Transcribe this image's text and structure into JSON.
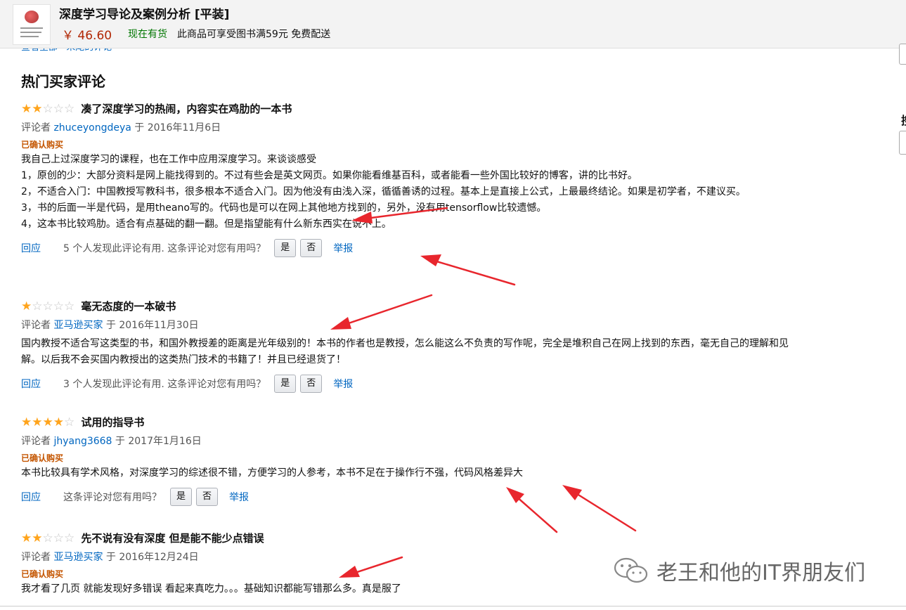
{
  "header": {
    "product_title": "深度学习导论及案例分析 [平装]",
    "price": "￥ 46.60",
    "stock": "现在有货",
    "promo": "此商品可享受图书满59元 免费配送",
    "cut_link": "查看全部 · 末尾的评论"
  },
  "section_title": "热门买家评论",
  "reviews": [
    {
      "rating": 2,
      "title": "凑了深度学习的热闹，内容实在鸡肋的一本书",
      "by_label": "评论者",
      "author": "zhuceyongdeya",
      "date": "于 2016年11月6日",
      "verified": "已确认购买",
      "body": [
        "我自己上过深度学习的课程，也在工作中应用深度学习。来谈谈感受",
        "1，原创的少：大部分资料是网上能找得到的。不过有些会是英文网页。如果你能看维基百科，或者能看一些外国比较好的博客，讲的比书好。",
        "2，不适合入门：中国教授写教科书，很多根本不适合入门。因为他没有由浅入深，循循善诱的过程。基本上是直接上公式，上最最终结论。如果是初学者，不建议买。",
        "3，书的后面一半是代码，是用theano写的。代码也是可以在网上其他地方找到的，另外，没有用tensorflow比较遗憾。",
        "4，这本书比较鸡肋。适合有点基础的翻一翻。但是指望能有什么新东西实在说不上。"
      ],
      "reply": "回应",
      "helpful": "5 个人发现此评论有用. 这条评论对您有用吗？",
      "yes": "是",
      "no": "否",
      "report": "举报"
    },
    {
      "rating": 1,
      "title": "毫无态度的一本破书",
      "by_label": "评论者",
      "author": "亚马逊买家",
      "date": "于 2016年11月30日",
      "verified": "",
      "body": [
        "国内教授不适合写这类型的书，和国外教授差的距离是光年级别的！本书的作者也是教授，怎么能这么不负责的写作呢，完全是堆积自己在网上找到的东西，毫无自己的理解和见解。以后我不会买国内教授出的这类热门技术的书籍了！并且已经退货了！"
      ],
      "reply": "回应",
      "helpful": "3 个人发现此评论有用. 这条评论对您有用吗？",
      "yes": "是",
      "no": "否",
      "report": "举报"
    },
    {
      "rating": 4,
      "title": "试用的指导书",
      "by_label": "评论者",
      "author": "jhyang3668",
      "date": "于 2017年1月16日",
      "verified": "已确认购买",
      "body": [
        "本书比较具有学术风格，对深度学习的综述很不错，方便学习的人参考，本书不足在于操作行不强，代码风格差异大"
      ],
      "reply": "回应",
      "helpful": "这条评论对您有用吗？",
      "yes": "是",
      "no": "否",
      "report": "举报"
    },
    {
      "rating": 2,
      "title": "先不说有没有深度 但是能不能少点错误",
      "by_label": "评论者",
      "author": "亚马逊买家",
      "date": "于 2016年12月24日",
      "verified": "已确认购买",
      "body": [
        "我才看了几页 就能发现好多错误 看起来真吃力。。。基础知识都能写错那么多。真是服了"
      ],
      "reply": "",
      "helpful": "",
      "yes": "",
      "no": "",
      "report": ""
    }
  ],
  "watermark": "老王和他的IT界朋友们",
  "colors": {
    "star": "#ffa41c",
    "link": "#0066c0",
    "price": "#b12704",
    "stock": "#007600",
    "verified": "#c45500",
    "arrow": "#e8262d"
  }
}
